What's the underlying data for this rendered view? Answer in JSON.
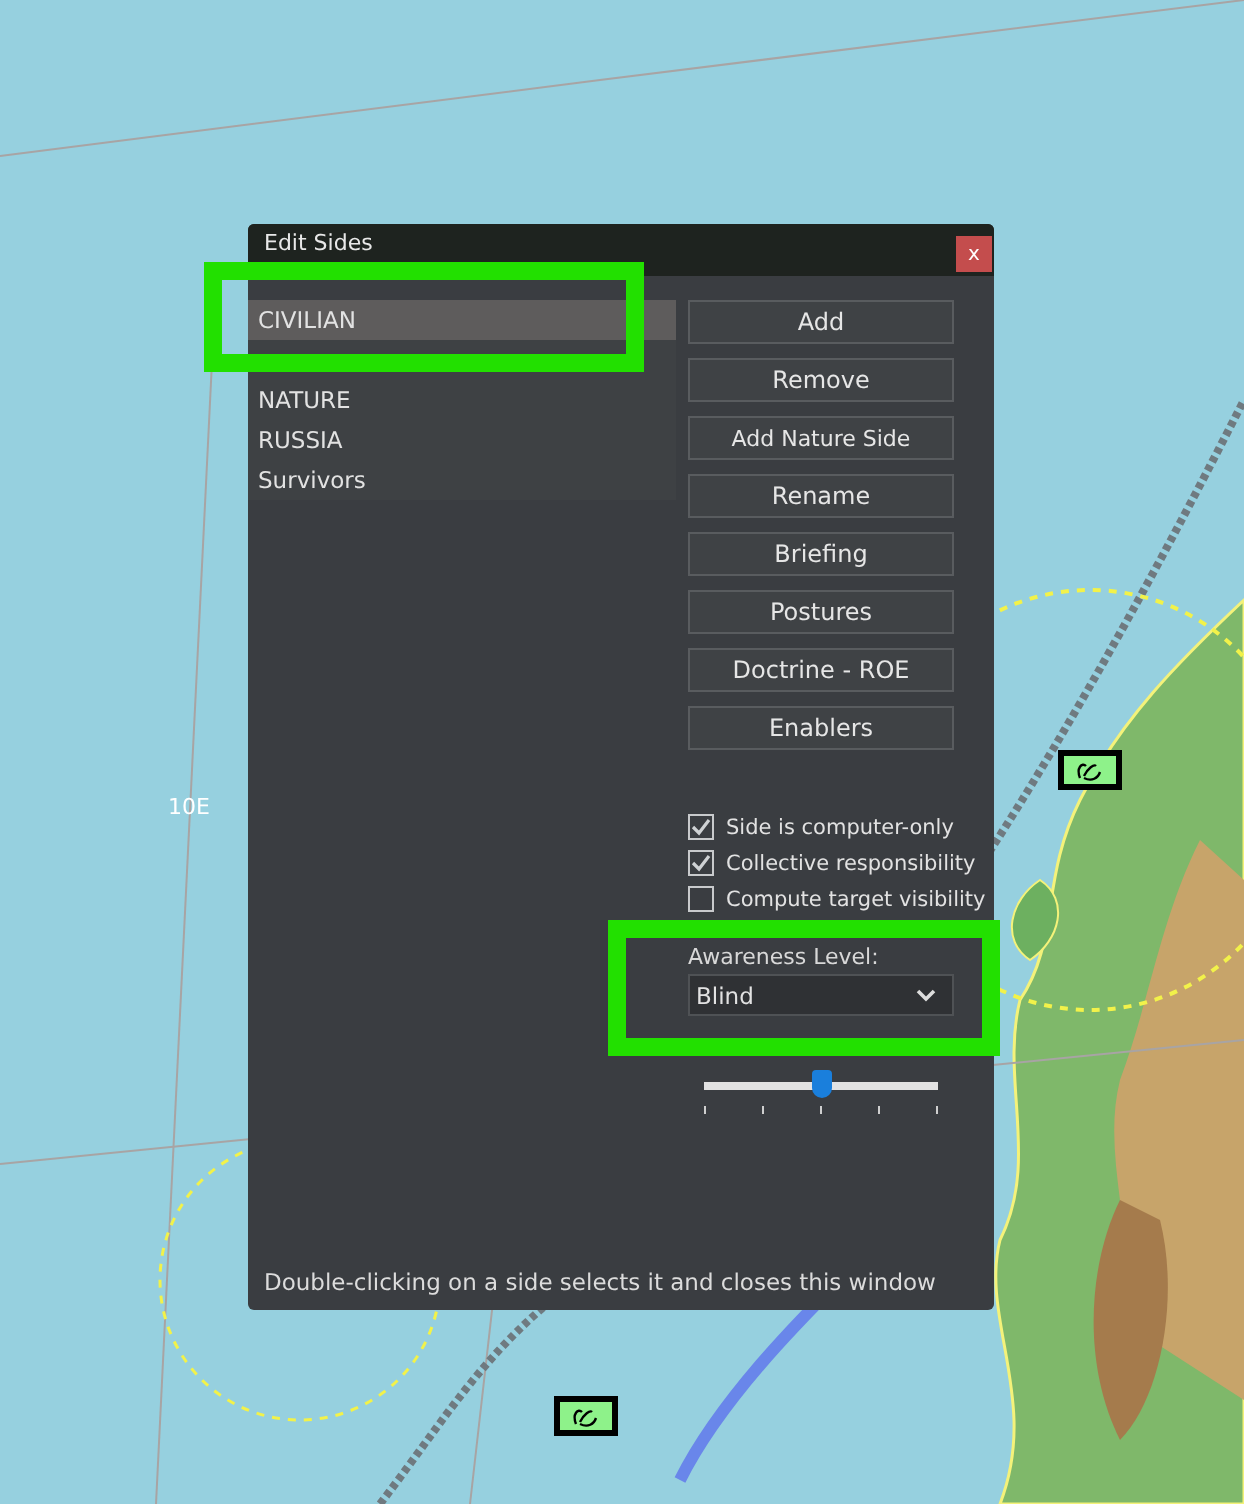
{
  "map": {
    "kind": "picture",
    "grid_labels": [
      "10E"
    ],
    "units": [
      {
        "kind": "unit"
      },
      {
        "kind": "unit"
      }
    ]
  },
  "window": {
    "title": "Edit Sides",
    "close": "x"
  },
  "sides": [
    {
      "name": "CIVILIAN",
      "selected": true
    },
    {
      "selected": false
    },
    {
      "name": "NATURE",
      "selected": false
    },
    {
      "name": "RUSSIA",
      "selected": false
    },
    {
      "name": "Survivors",
      "selected": false
    }
  ],
  "buttons": [
    "Add",
    "Remove",
    "Add Nature Side",
    "Rename",
    "Briefing",
    "Postures",
    "Doctrine - ROE",
    "Enablers"
  ],
  "options": [
    {
      "label": "Side is computer-only",
      "checked": true
    },
    {
      "label": "Collective responsibility",
      "checked": true
    },
    {
      "label": "Compute target visibility",
      "checked": false
    }
  ],
  "awareness": {
    "label": "Awareness Level:",
    "value": "Blind"
  },
  "proficiency": {
    "level": 0.5
  },
  "hint": "Double-clicking on a side selects it and closes this window"
}
